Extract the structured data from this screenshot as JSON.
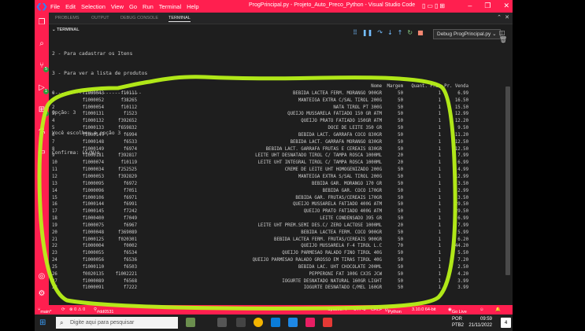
{
  "titlebar": {
    "menu": [
      "File",
      "Edit",
      "Selection",
      "View",
      "Go",
      "Run",
      "Terminal",
      "Help"
    ],
    "window_title": "ProgPrincipal.py - Projeto_Auto_Preco_Python - Visual Studio Code"
  },
  "panel_tabs": [
    "PROBLEMS",
    "OUTPUT",
    "DEBUG CONSOLE",
    "TERMINAL"
  ],
  "terminal_section": "TERMINAL",
  "debug_config": "Debug ProgPrincipal.py",
  "terminal_lines": [
    "2 - Para cadastrar os Itens",
    "3 - Para ver a lista de produtos",
    "------------------------------",
    "Opção: 3",
    "Você escolheu a opção 3",
    "Confirma: (S/N)s"
  ],
  "table": {
    "header": {
      "nome": "Nome",
      "margem": "Margem",
      "quant": "Quant. Frac",
      "preco": "Pr. Venda"
    },
    "rows": [
      [
        "0",
        "f1000043",
        "f10111",
        "BEBIDA LACTEA FERM. MORANGO 900GR",
        "50",
        "1",
        "6.99"
      ],
      [
        "1",
        "f1000052",
        "f38265",
        "MANTEIGA EXTRA C/SAL TIROL 200G",
        "50",
        "1",
        "16.50"
      ],
      [
        "2",
        "f1000054",
        "f10112",
        "NATA TIROL PT 300G",
        "50",
        "1",
        "15.50"
      ],
      [
        "3",
        "f1000131",
        "f1523",
        "QUEIJO MUSSARELA FATIADO 150 GR ATM",
        "50",
        "1",
        "12.99"
      ],
      [
        "4",
        "f1000132",
        "f392652",
        "QUEIJO PRATO FATIADO 150GR ATM",
        "50",
        "1",
        "12.20"
      ],
      [
        "5",
        "f1000133",
        "f659832",
        "DOCE DE LEITE 350 GR",
        "50",
        "1",
        "9.50"
      ],
      [
        "6",
        "f1000147",
        "f6994",
        "BEBIDA LACT. GARRAFA COCO 830GR",
        "50",
        "1",
        "11.20"
      ],
      [
        "7",
        "f1000148",
        "f6533",
        "BEBIDA LACT. GARRAFA MORANGO 830GR",
        "50",
        "1",
        "12.50"
      ],
      [
        "8",
        "f1000149",
        "f6974",
        "BEBIDA LACT. GARRAFA FRUTAS E CEREAIS 830GR",
        "50",
        "1",
        "12.50"
      ],
      [
        "9",
        "f1000181",
        "f392817",
        "LEITE UHT DESNATADO TIROL C/ TAMPA ROSCA 1000ML",
        "20",
        "1",
        "7.99"
      ],
      [
        "10",
        "f1000074",
        "f10119",
        "LEITE UHT INTEGRAL TIROL C/ TAMPA ROSCA 1000ML",
        "20",
        "1",
        "6.99"
      ],
      [
        "11",
        "f1000034",
        "f252525",
        "CREME DE LEITE UHT HOMOGENIZADO 200G",
        "50",
        "1",
        "4.99"
      ],
      [
        "12",
        "f1000053",
        "f392829",
        "MANTEIGA EXTRA S/SAL TIROL 200G",
        "50",
        "1",
        "12.99"
      ],
      [
        "13",
        "f1000095",
        "f6972",
        "BEBIDA GAR. MORANGO 170 GR",
        "50",
        "1",
        "3.50"
      ],
      [
        "14",
        "f1000096",
        "f7051",
        "BEBIDA GAR. COCO 170GR",
        "50",
        "1",
        "2.99"
      ],
      [
        "15",
        "f1000106",
        "f6971",
        "BEBIDA GAR. FRUTAS/CEREAIS 170GR",
        "50",
        "1",
        "3.50"
      ],
      [
        "16",
        "f1000144",
        "f6991",
        "QUEIJO MUSSARELA FATIADO 400G ATM",
        "50",
        "1",
        "29.50"
      ],
      [
        "17",
        "f1000145",
        "f7242",
        "QUEIJO PRATO FATIADO 400G ATM",
        "50",
        "1",
        "29.50"
      ],
      [
        "18",
        "f1000400",
        "f7049",
        "LEITE CONDENSADO 395 GR",
        "50",
        "1",
        "6.99"
      ],
      [
        "19",
        "f1000075",
        "f6967",
        "LEITE UHT PREM.SEMI DES.C/ ZERO LACTOSE 1000ML",
        "20",
        "1",
        "7.99"
      ],
      [
        "20",
        "f1000048",
        "f369089",
        "BEBIDA LACTEA FERM. COCO 900GR",
        "50",
        "1",
        "5.99"
      ],
      [
        "21",
        "f1000125",
        "f020301",
        "BEBIDA LACTEA FERM. FRUTAS/CEREAIS 900GR",
        "50",
        "1",
        "6.20"
      ],
      [
        "22",
        "f1000004",
        "f0002",
        "QUEIJO MUSSARELA F-4 TIROL L.C",
        "70",
        "1",
        "44.20"
      ],
      [
        "23",
        "f1000055",
        "f6534",
        "QUEIJO PARMESAO RALADO FINO TIROL 40G",
        "50",
        "1",
        "5.50"
      ],
      [
        "24",
        "f1000056",
        "f6536",
        "QUEIJO PARMESAO RALADO GROSSO EM TIRAS TIROL 40G",
        "50",
        "1",
        "7.20"
      ],
      [
        "25",
        "f1000110",
        "f6503",
        "BEBIDA LAC. UHT CHOCOLATE 200ML",
        "50",
        "1",
        "2.50"
      ],
      [
        "26",
        "f0020135",
        "f1002221",
        "PEPPERONI FAT 100G CX35 JCW",
        "50",
        "1",
        "4.20"
      ],
      [
        "27",
        "f1000089",
        "f6568",
        "IOGURTE DESNATADO NATURAL 160GR LIGHT",
        "50",
        "1",
        "3.99"
      ],
      [
        "28",
        "f1000091",
        "f7222",
        "IOGURTE DESNATADO C/MEL 160GR",
        "50",
        "1",
        "3.99"
      ]
    ]
  },
  "statusbar": {
    "branch": "main*",
    "problems": "⊗ 0 ⚠ 0",
    "commit": "#dd0531",
    "spaces": "Spaces: 4",
    "encoding": "UTF-8",
    "eol": "CRLF",
    "language": "Python",
    "interpreter": "3.10.0 64-bit",
    "golive": "Go Live"
  },
  "taskbar": {
    "search_placeholder": "Digite aqui para pesquisar",
    "lang": "POR",
    "lang2": "PTB2",
    "time": "09:59",
    "date": "21/11/2022",
    "notif_count": "4"
  },
  "colors": {
    "accent": "#ff1f4f",
    "highlight": "#b8f218",
    "terminal_bg": "#1e1e1e"
  }
}
